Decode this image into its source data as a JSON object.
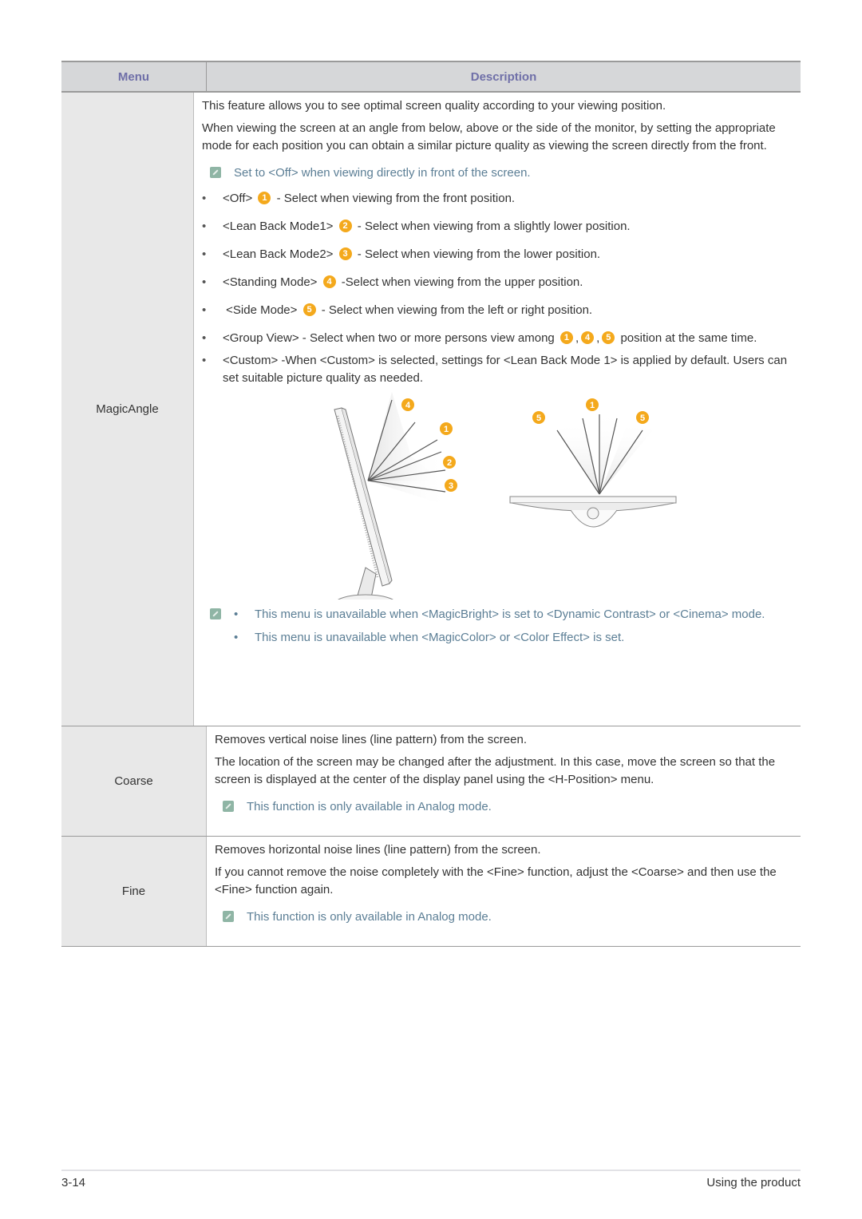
{
  "table": {
    "header": {
      "menu": "Menu",
      "description": "Description"
    },
    "rows": [
      {
        "menu": "MagicAngle",
        "paragraphs": [
          "This feature allows you to see optimal screen quality according to your viewing position.",
          "When viewing the screen at an angle from below, above or the side of the monitor, by setting the appropriate mode for each position you can obtain a similar picture quality as viewing the screen directly from the front."
        ],
        "note": "Set to <Off> when viewing directly in front of the screen.",
        "modes": [
          {
            "label": "<Off>",
            "badge": "1",
            "text": "- Select when viewing from the front position."
          },
          {
            "label": "<Lean Back Mode1>",
            "badge": "2",
            "text": "- Select when viewing from a slightly lower position."
          },
          {
            "label": "<Lean Back Mode2>",
            "badge": "3",
            "text": "- Select when viewing from the lower position."
          },
          {
            "label": "<Standing Mode>",
            "badge": "4",
            "text": "-Select when viewing from the upper position."
          },
          {
            "label": " <Side Mode>",
            "badge": "5",
            "text": "- Select when viewing from the left or right position."
          }
        ],
        "group_view": {
          "text": "<Group View>  - Select when two or more persons view among",
          "badges": [
            "1",
            "4",
            "5"
          ],
          "suffix": "position at the same time."
        },
        "custom": " <Custom> -When <Custom> is selected, settings for <Lean Back Mode 1> is applied by default. Users can set suitable picture quality as needed.",
        "figure_side_badges": [
          "4",
          "1",
          "2",
          "3"
        ],
        "figure_top_badges": [
          "5",
          "1",
          "5"
        ],
        "notes": [
          "This menu is unavailable when <MagicBright> is set to <Dynamic Contrast> or <Cinema> mode.",
          "This menu is unavailable when <MagicColor> or <Color Effect> is set."
        ]
      },
      {
        "menu": "Coarse",
        "paragraphs": [
          "Removes vertical noise lines (line pattern) from the screen.",
          "The location of the screen may be changed after the adjustment. In this case, move the screen so that the screen is displayed at the center of the display panel using the <H-Position> menu."
        ],
        "note": "This function is only available in Analog mode."
      },
      {
        "menu": "Fine",
        "paragraphs": [
          "Removes horizontal noise lines (line pattern) from the screen.",
          "If you cannot remove the noise completely with the <Fine> function, adjust the <Coarse> and then use the <Fine> function again."
        ],
        "note": "This function is only available in Analog mode."
      }
    ]
  },
  "footer": {
    "page": "3-14",
    "section": "Using the product"
  },
  "colors": {
    "header_text": "#6f6fa8",
    "note_text": "#5b7e95",
    "badge": "#f4a91c",
    "menu_bg": "#e8e8e8",
    "header_bg": "#d6d7d9"
  }
}
